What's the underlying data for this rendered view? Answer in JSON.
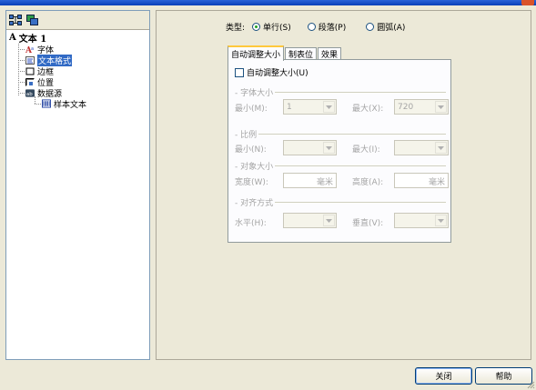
{
  "window": {
    "title_accent": "#0a3fb8",
    "close_color": "#d9532a"
  },
  "toolbar": {
    "icons": [
      "network-icon",
      "layers-icon"
    ]
  },
  "tree": {
    "root": {
      "glyph": "A",
      "label": "文本 1"
    },
    "items": [
      {
        "label": "字体",
        "icon": "font-icon"
      },
      {
        "label": "文本格式",
        "icon": "text-format-icon",
        "selected": true
      },
      {
        "label": "边框",
        "icon": "border-icon"
      },
      {
        "label": "位置",
        "icon": "position-icon"
      },
      {
        "label": "数据源",
        "icon": "datasource-icon"
      }
    ],
    "sub_items": [
      {
        "label": "样本文本",
        "icon": "sample-text-icon"
      }
    ]
  },
  "type_row": {
    "label": "类型:",
    "options": [
      {
        "label": "单行(S)",
        "selected": true
      },
      {
        "label": "段落(P)",
        "selected": false
      },
      {
        "label": "圆弧(A)",
        "selected": false
      }
    ]
  },
  "tabs": [
    {
      "label": "自动调整大小",
      "active": true
    },
    {
      "label": "制表位",
      "active": false
    },
    {
      "label": "效果",
      "active": false
    }
  ],
  "autosize": {
    "checkbox_label": "自动调整大小(U)",
    "checked": false,
    "font_size_group": "字体大小",
    "min_label": "最小(M):",
    "min_value": "1",
    "max_label": "最大(X):",
    "max_value": "720",
    "ratio_group": "比例",
    "ratio_min_label": "最小(N):",
    "ratio_max_label": "最大(I):",
    "object_size_group": "对象大小",
    "width_label": "宽度(W):",
    "width_unit": "毫米",
    "height_label": "高度(A):",
    "height_unit": "毫米",
    "align_group": "对齐方式",
    "halign_label": "水平(H):",
    "valign_label": "垂直(V):"
  },
  "buttons": {
    "close": "关闭",
    "help": "帮助"
  }
}
